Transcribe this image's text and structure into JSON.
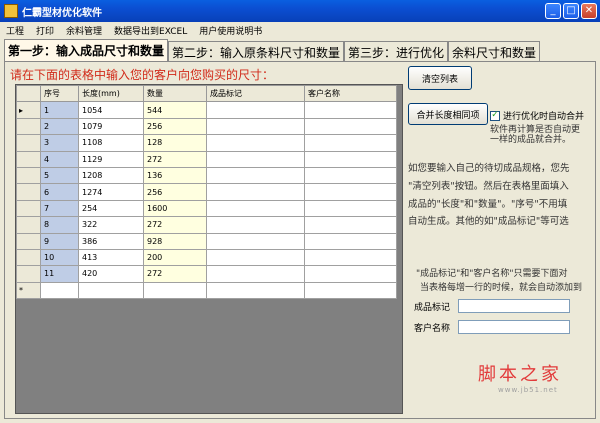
{
  "window": {
    "title": "仁霸型材优化软件",
    "minimize": "_",
    "maximize": "□",
    "close": "✕"
  },
  "menu": [
    "工程",
    "打印",
    "余料管理",
    "数据导出到EXCEL",
    "用户使用说明书"
  ],
  "tabs": [
    {
      "label": "第一步：输入成品尺寸和数量",
      "active": true
    },
    {
      "label": "第二步：输入原条料尺寸和数量",
      "active": false
    },
    {
      "label": "第三步：进行优化",
      "active": false
    },
    {
      "label": "余料尺寸和数量",
      "active": false
    }
  ],
  "instruction": "请在下面的表格中输入您的客户向您购买的尺寸：",
  "grid": {
    "columns": [
      "序号",
      "长度(mm)",
      "数量",
      "成品标记",
      "客户名称"
    ],
    "rows": [
      [
        "1",
        "1054",
        "544",
        "",
        ""
      ],
      [
        "2",
        "1079",
        "256",
        "",
        ""
      ],
      [
        "3",
        "1108",
        "128",
        "",
        ""
      ],
      [
        "4",
        "1129",
        "272",
        "",
        ""
      ],
      [
        "5",
        "1208",
        "136",
        "",
        ""
      ],
      [
        "6",
        "1274",
        "256",
        "",
        ""
      ],
      [
        "7",
        "254",
        "1600",
        "",
        ""
      ],
      [
        "8",
        "322",
        "272",
        "",
        ""
      ],
      [
        "9",
        "386",
        "928",
        "",
        ""
      ],
      [
        "10",
        "413",
        "200",
        "",
        ""
      ],
      [
        "11",
        "420",
        "272",
        "",
        ""
      ]
    ],
    "current_row_marker": "▸",
    "new_row_marker": "*"
  },
  "right": {
    "clear_button": "清空列表",
    "merge_button": "合并长度相同项",
    "auto_merge_checkbox": "进行优化时自动合并",
    "auto_merge_checked": true,
    "note_line1": "软件再计算是否自动更",
    "note_line2": "一样的成品就合并。",
    "info_lines": [
      "如您要输入自己的待切成品规格，您先",
      "\"清空列表\"按钮。然后在表格里面填入",
      "成品的\"长度\"和\"数量\"。\"序号\"不用填",
      "自动生成。其他的如\"成品标记\"等可选"
    ],
    "hint_line1": "\"成品标记\"和\"客户名称\"只需要下面对",
    "hint_line2": "当表格每增一行的时候，就会自动添加到",
    "mark_label": "成品标记",
    "mark_value": "",
    "customer_label": "客户名称",
    "customer_value": ""
  },
  "watermark": {
    "text": "脚本之家",
    "url": "www.jb51.net"
  }
}
